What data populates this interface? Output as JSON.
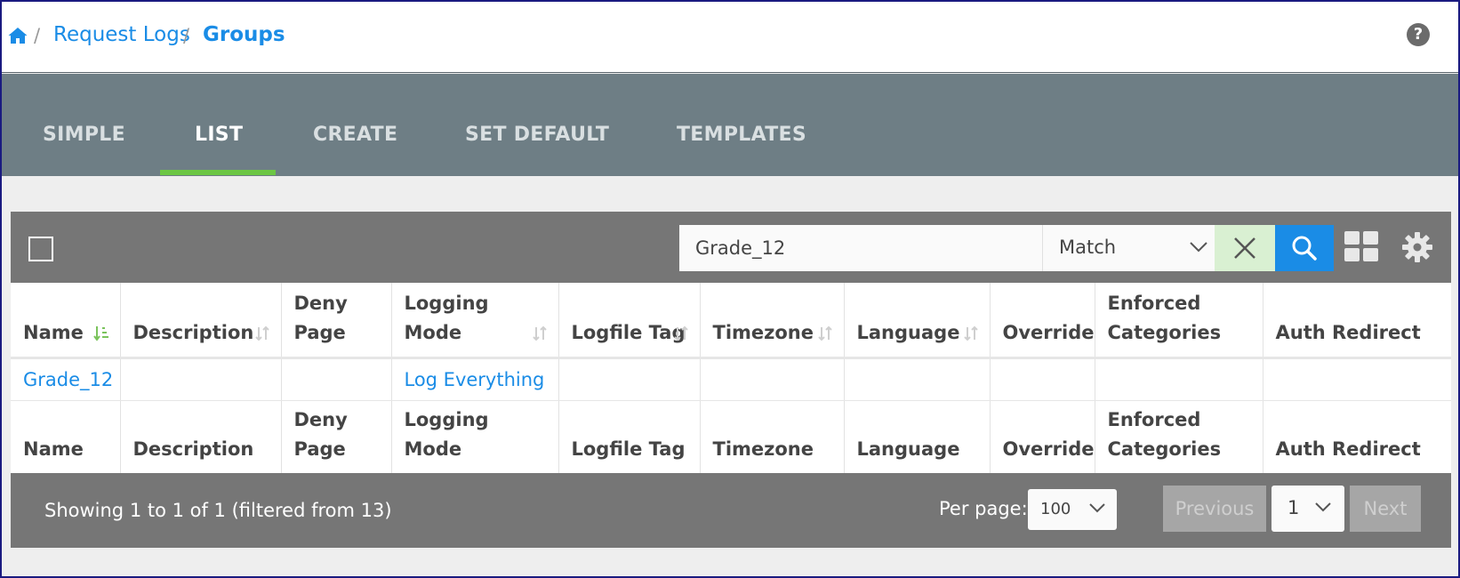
{
  "breadcrumb": {
    "home_icon": "home-icon",
    "separator": "/",
    "parent": "Request Logs",
    "current": "Groups"
  },
  "help_icon": {
    "name": "help-icon",
    "glyph": "?"
  },
  "tabs": [
    {
      "label": "SIMPLE",
      "active": false
    },
    {
      "label": "LIST",
      "active": true
    },
    {
      "label": "CREATE",
      "active": false
    },
    {
      "label": "SET DEFAULT",
      "active": false
    },
    {
      "label": "TEMPLATES",
      "active": false
    }
  ],
  "colors": {
    "accent": "#1a8ce6",
    "tab_bar": "#6e7e85",
    "active_tab_underline": "#6cc644",
    "toolbar": "#767676"
  },
  "toolbar": {
    "search_value": "Grade_12",
    "match_option": "Match",
    "clear_icon": "close-icon",
    "search_icon": "search-icon",
    "layout_icon": "grid-icon",
    "settings_icon": "gear-icon"
  },
  "table": {
    "columns": [
      {
        "label": "Name",
        "sortable": true,
        "sorted": "ascending"
      },
      {
        "label": "Description",
        "sortable": true
      },
      {
        "label": "Deny Page",
        "sortable": false
      },
      {
        "label": "Logging Mode",
        "sortable": true
      },
      {
        "label": "Logfile Tag",
        "sortable": true
      },
      {
        "label": "Timezone",
        "sortable": true
      },
      {
        "label": "Language",
        "sortable": true
      },
      {
        "label": "Override",
        "sortable": false
      },
      {
        "label": "Enforced Categories",
        "sortable": false
      },
      {
        "label": "Auth Redirect",
        "sortable": false
      }
    ],
    "rows": [
      {
        "name": "Grade_12",
        "description": "",
        "deny_page": "",
        "logging_mode": "Log Everything",
        "logfile_tag": "",
        "timezone": "",
        "language": "",
        "override": "",
        "enforced_categories": "",
        "auth_redirect": ""
      }
    ]
  },
  "footer": {
    "showing": "Showing 1 to 1 of 1 (filtered from 13)",
    "per_page_label": "Per page:",
    "per_page_value": "100",
    "previous_label": "Previous",
    "page_value": "1",
    "next_label": "Next"
  }
}
